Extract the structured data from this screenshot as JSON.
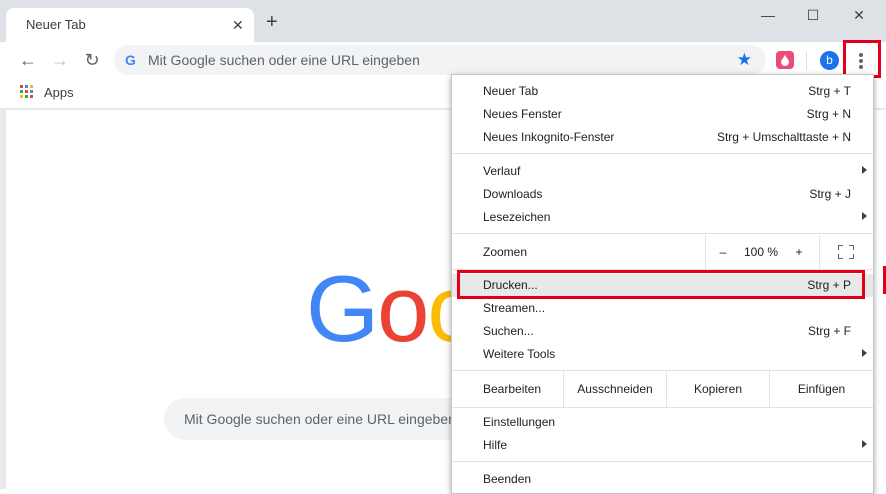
{
  "tab": {
    "title": "Neuer Tab",
    "close": "✕"
  },
  "window": {
    "minimize": "—",
    "maximize": "☐",
    "close": "✕",
    "new_tab": "+"
  },
  "omnibox": {
    "placeholder": "Mit Google suchen oder eine URL eingeben",
    "engine_letter": "G"
  },
  "profile": {
    "initial": "b"
  },
  "bookmarks": {
    "apps_label": "Apps"
  },
  "page": {
    "logo_letters": [
      "G",
      "o",
      "o"
    ],
    "logo_colors": [
      "#4285f4",
      "#ea4335",
      "#fbbc05"
    ],
    "search_placeholder": "Mit Google suchen oder eine URL eingeben"
  },
  "menu": {
    "group1": [
      {
        "label": "Neuer Tab",
        "shortcut": "Strg + T"
      },
      {
        "label": "Neues Fenster",
        "shortcut": "Strg + N"
      },
      {
        "label": "Neues Inkognito-Fenster",
        "shortcut": "Strg + Umschalttaste + N"
      }
    ],
    "group2": [
      {
        "label": "Verlauf",
        "shortcut": ""
      },
      {
        "label": "Downloads",
        "shortcut": "Strg + J"
      },
      {
        "label": "Lesezeichen",
        "shortcut": ""
      }
    ],
    "zoom": {
      "label": "Zoomen",
      "minus": "–",
      "value": "100 %",
      "plus": "+"
    },
    "group3": [
      {
        "label": "Drucken...",
        "shortcut": "Strg + P"
      },
      {
        "label": "Streamen...",
        "shortcut": ""
      },
      {
        "label": "Suchen...",
        "shortcut": "Strg + F"
      },
      {
        "label": "Weitere Tools",
        "shortcut": ""
      }
    ],
    "edit": {
      "label": "Bearbeiten",
      "cut": "Ausschneiden",
      "copy": "Kopieren",
      "paste": "Einfügen"
    },
    "group4": [
      {
        "label": "Einstellungen",
        "shortcut": ""
      },
      {
        "label": "Hilfe",
        "shortcut": ""
      }
    ],
    "quit": {
      "label": "Beenden"
    }
  },
  "colors": {
    "highlight_red": "#e0001b",
    "accent_blue": "#1a73e8",
    "tabstrip": "#dee1e6"
  }
}
